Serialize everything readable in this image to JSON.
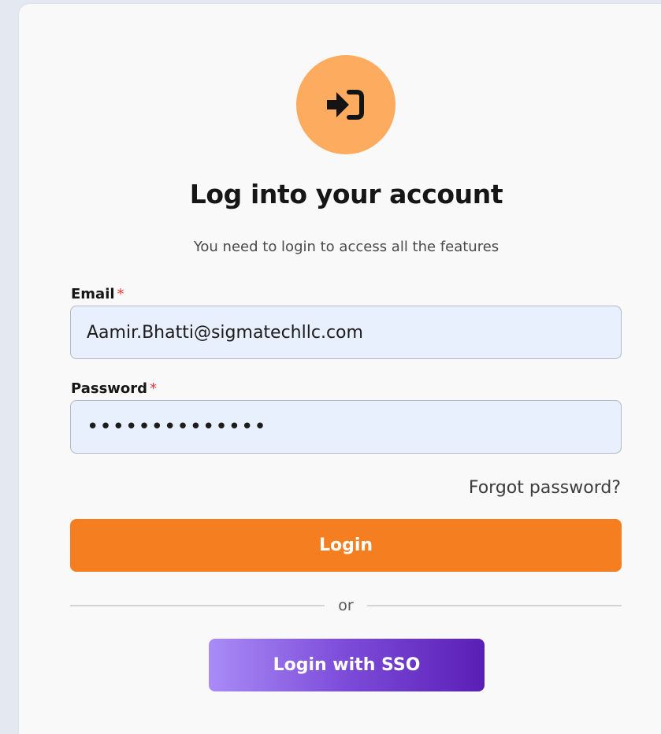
{
  "header": {
    "icon": "login-arrow-icon",
    "title": "Log into your account",
    "subtitle": "You need to login to access all the features"
  },
  "form": {
    "email_label": "Email",
    "email_value": "Aamir.Bhatti@sigmatechllc.com",
    "password_label": "Password",
    "password_value": "••••••••••••••",
    "required_marker": "*",
    "forgot_password": "Forgot password?",
    "login_button": "Login",
    "divider_text": "or",
    "sso_button": "Login with SSO"
  },
  "colors": {
    "accent": "#f57f20",
    "icon_circle": "#fdab5e",
    "sso_gradient_start": "#a98cf6",
    "sso_gradient_end": "#5a1fb5",
    "input_bg": "#e7f0fc",
    "required": "#e53935"
  }
}
